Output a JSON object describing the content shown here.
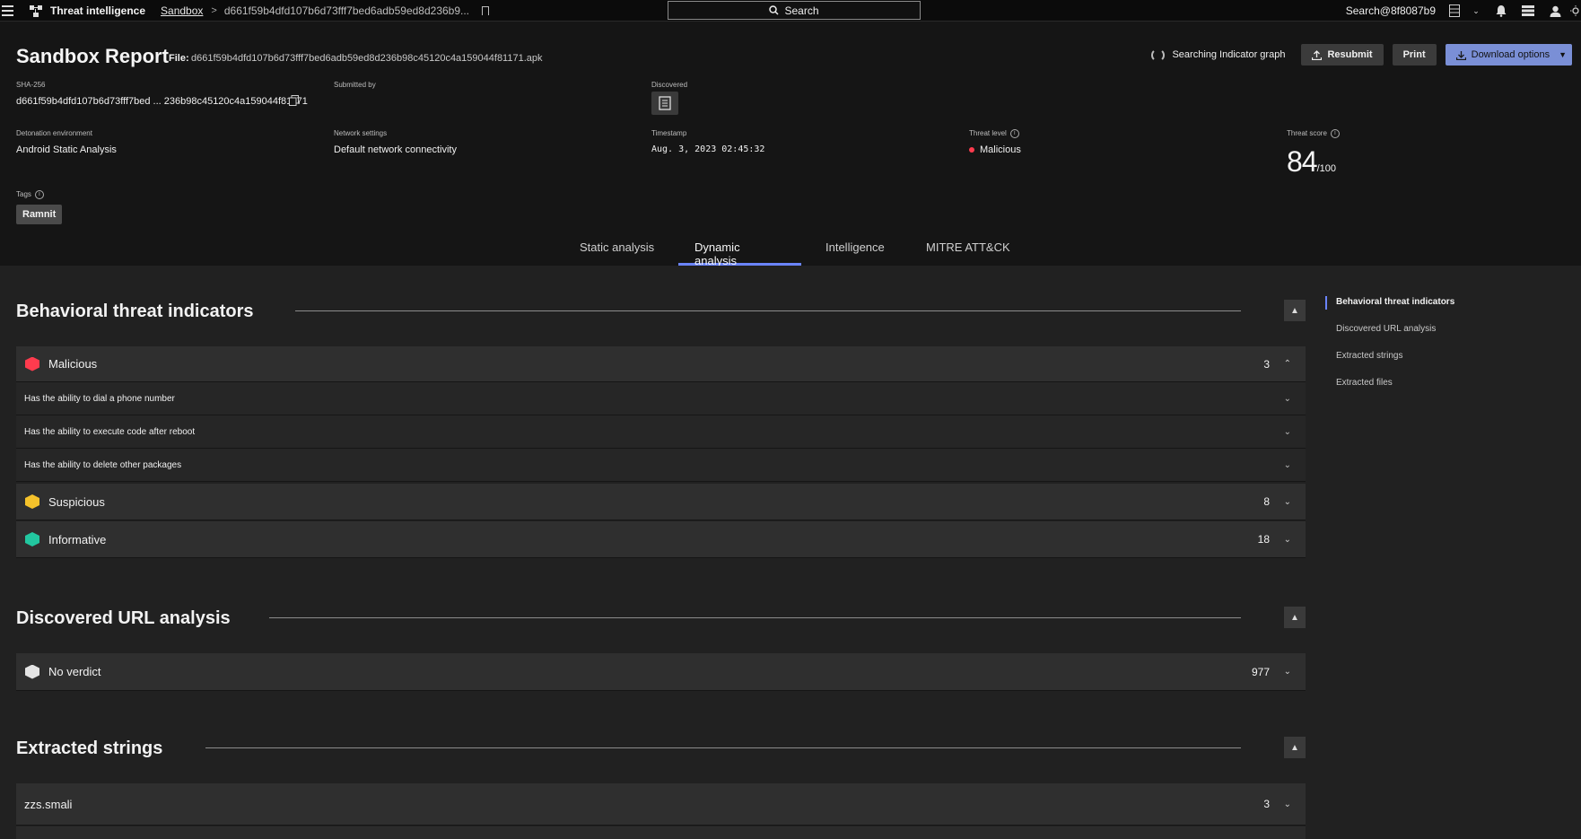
{
  "topbar": {
    "app_title": "Threat intelligence",
    "breadcrumb_sandbox": "Sandbox",
    "breadcrumb_hash": "d661f59b4dfd107b6d73fff7bed6adb59ed8d236b9...",
    "search_label": "Search",
    "user": "Search@8f8087b9"
  },
  "header": {
    "title": "Sandbox Report",
    "file_label": "File:",
    "file_name": "d661f59b4dfd107b6d73fff7bed6adb59ed8d236b98c45120c4a159044f81171.apk",
    "searching_label": "Searching Indicator graph",
    "resubmit_label": "Resubmit",
    "print_label": "Print",
    "download_label": "Download options"
  },
  "meta": {
    "sha_label": "SHA-256",
    "sha_value": "d661f59b4dfd107b6d73fff7bed ... 236b98c45120c4a159044f81171",
    "submitted_label": "Submitted by",
    "discovered_label": "Discovered",
    "env_label": "Detonation environment",
    "env_value": "Android Static Analysis",
    "network_label": "Network settings",
    "network_value": "Default network connectivity",
    "timestamp_label": "Timestamp",
    "timestamp_value": "Aug. 3, 2023 02:45:32",
    "threat_level_label": "Threat level",
    "threat_level_value": "Malicious",
    "threat_score_label": "Threat score",
    "threat_score_value": "84",
    "threat_score_max": "/100",
    "tags_label": "Tags",
    "tag": "Ramnit"
  },
  "tabs": [
    "Static analysis",
    "Dynamic analysis",
    "Intelligence",
    "MITRE ATT&CK"
  ],
  "active_tab": "Dynamic analysis",
  "sections": {
    "behavioral": {
      "title": "Behavioral threat indicators",
      "groups": [
        {
          "label": "Malicious",
          "count": "3",
          "color": "#ff3b4e"
        },
        {
          "label": "Suspicious",
          "count": "8",
          "color": "#f5c22b"
        },
        {
          "label": "Informative",
          "count": "18",
          "color": "#22c7a0"
        }
      ],
      "malicious_items": [
        "Has the ability to dial a phone number",
        "Has the ability to execute code after reboot",
        "Has the ability to delete other packages"
      ]
    },
    "urls": {
      "title": "Discovered URL analysis",
      "groups": [
        {
          "label": "No verdict",
          "count": "977",
          "color": "#e4e4e4"
        }
      ]
    },
    "strings": {
      "title": "Extracted strings",
      "groups": [
        {
          "label": "zzs.smali",
          "count": "3"
        }
      ]
    }
  },
  "right_nav": [
    "Behavioral threat indicators",
    "Discovered URL analysis",
    "Extracted strings",
    "Extracted files"
  ]
}
